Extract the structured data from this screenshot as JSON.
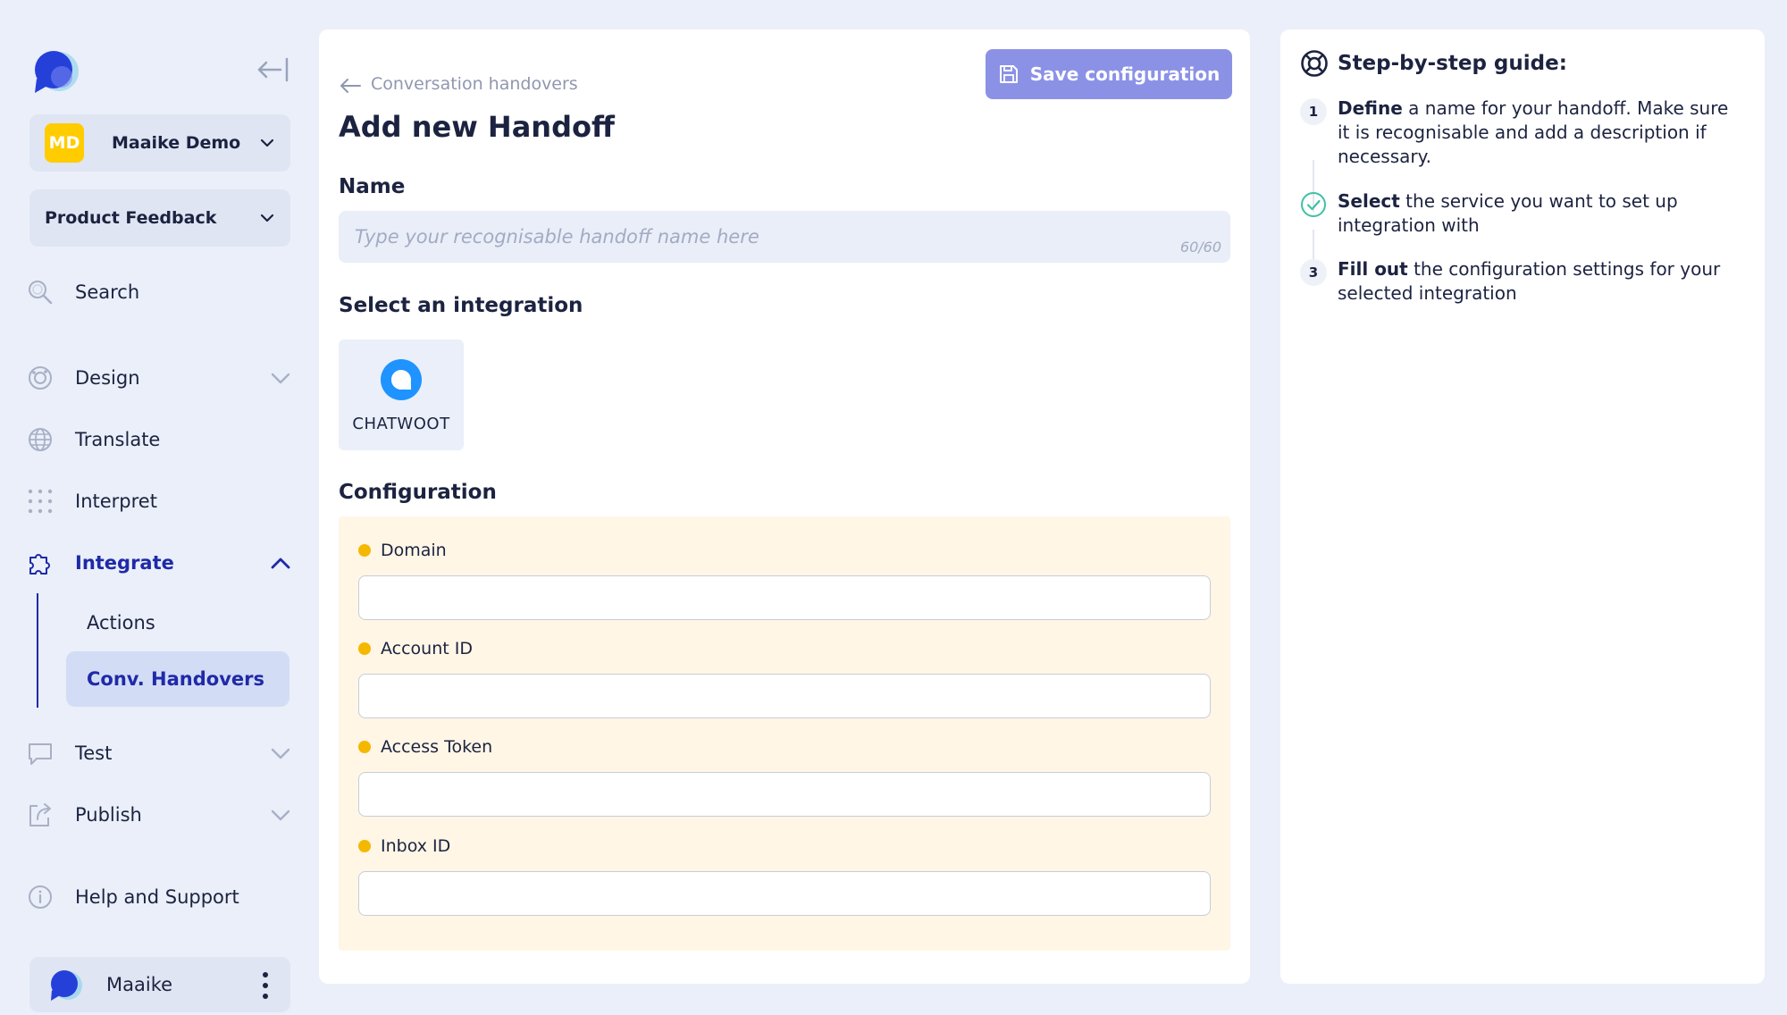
{
  "sidebar": {
    "workspace": {
      "initials": "MD",
      "name": "Maaike Demo"
    },
    "project": {
      "name": "Product Feedback"
    },
    "nav": {
      "search": "Search",
      "design": "Design",
      "translate": "Translate",
      "interpret": "Interpret",
      "integrate": "Integrate",
      "test": "Test",
      "publish": "Publish",
      "help": "Help and Support"
    },
    "integrate_sub": {
      "actions": "Actions",
      "handovers": "Conv. Handovers"
    },
    "user": {
      "name": "Maaike"
    }
  },
  "main": {
    "breadcrumb": "Conversation handovers",
    "save_label": "Save configuration",
    "title": "Add new Handoff",
    "name_section": "Name",
    "name_placeholder": "Type your recognisable handoff name here",
    "name_counter": "60/60",
    "integration_section": "Select an integration",
    "integration_name": "CHATWOOT",
    "config_section": "Configuration",
    "fields": {
      "domain": "Domain",
      "account_id": "Account ID",
      "access_token": "Access Token",
      "inbox_id": "Inbox ID"
    }
  },
  "guide": {
    "title": "Step-by-step guide:",
    "steps": [
      {
        "marker": "1",
        "bold": "Define",
        "text": " a name for your handoff. Make sure it is recognisable and add a description if necessary."
      },
      {
        "marker": "",
        "bold": "Select",
        "text": " the service you want to set up integration with"
      },
      {
        "marker": "3",
        "bold": "Fill out",
        "text": " the configuration settings for your selected integration"
      }
    ]
  },
  "colors": {
    "accent": "#1f2aa8",
    "save_button": "#8b92e6",
    "required_dot": "#f5b800",
    "config_bg": "#fff6e6",
    "workspace_avatar": "#ffcc00",
    "chatwoot_blue": "#1f93ff",
    "step_done": "#3fc1a5"
  },
  "icons": {
    "logo": "chat-bubble-logo-icon",
    "collapse": "collapse-sidebar-icon",
    "search": "search-icon",
    "design": "palette-icon",
    "translate": "globe-icon",
    "interpret": "dots-grid-icon",
    "integrate": "puzzle-icon",
    "test": "chat-bubble-icon",
    "publish": "share-icon",
    "help": "info-icon",
    "save": "floppy-disk-icon",
    "guide": "lifebuoy-icon",
    "step_done": "check-circle-icon"
  }
}
